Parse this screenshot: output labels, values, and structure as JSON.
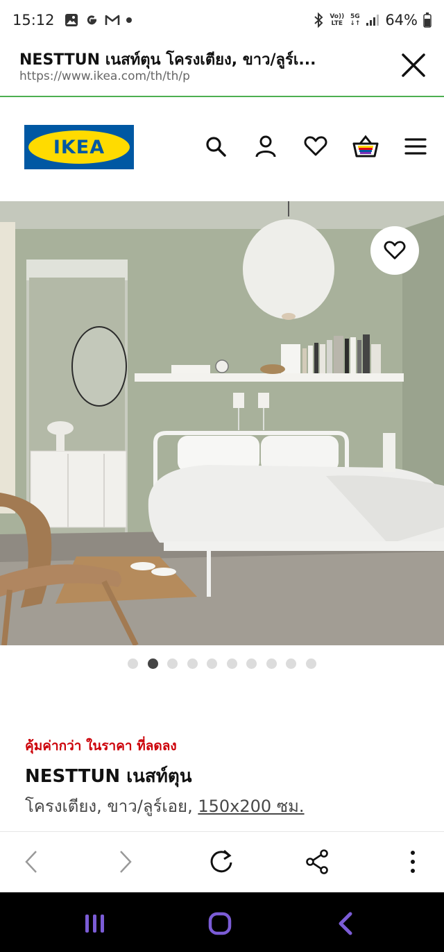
{
  "status_bar": {
    "time": "15:12",
    "left_icons": [
      "gallery-icon",
      "google-icon",
      "gmail-icon",
      "dot-icon"
    ],
    "right_icons": [
      "bluetooth-icon",
      "volte-icon",
      "5g-icon",
      "signal-icon"
    ],
    "volte_label_1": "Vo))",
    "volte_label_2": "LTE",
    "five_g_label": "5G",
    "battery": "64%"
  },
  "tab": {
    "title": "NESTTUN เนสท์ตุน โครงเตียง, ขาว/ลูร์เ...",
    "url": "https://www.ikea.com/th/th/p"
  },
  "site": {
    "logo_text": "IKEA",
    "brand_blue": "#0058a3",
    "brand_yellow": "#ffdb00",
    "header_icons": [
      "search-icon",
      "account-icon",
      "heart-icon",
      "cart-icon",
      "menu-icon"
    ]
  },
  "carousel": {
    "total": 10,
    "active_index": 1
  },
  "product": {
    "promo": "คุ้มค่ากว่า ในราคา ที่ลดลง",
    "name": "NESTTUN เนสท์ตุน",
    "desc_prefix": "โครงเตียง, ขาว/ลูร์เอย, ",
    "size": "150x200 ซม.",
    "promo_color": "#cc0008"
  },
  "browser_bar": {
    "buttons": [
      "back-icon",
      "forward-icon",
      "refresh-icon",
      "share-icon",
      "more-icon"
    ]
  },
  "system_nav": {
    "buttons": [
      "recents-icon",
      "home-icon",
      "back-nav-icon"
    ]
  }
}
